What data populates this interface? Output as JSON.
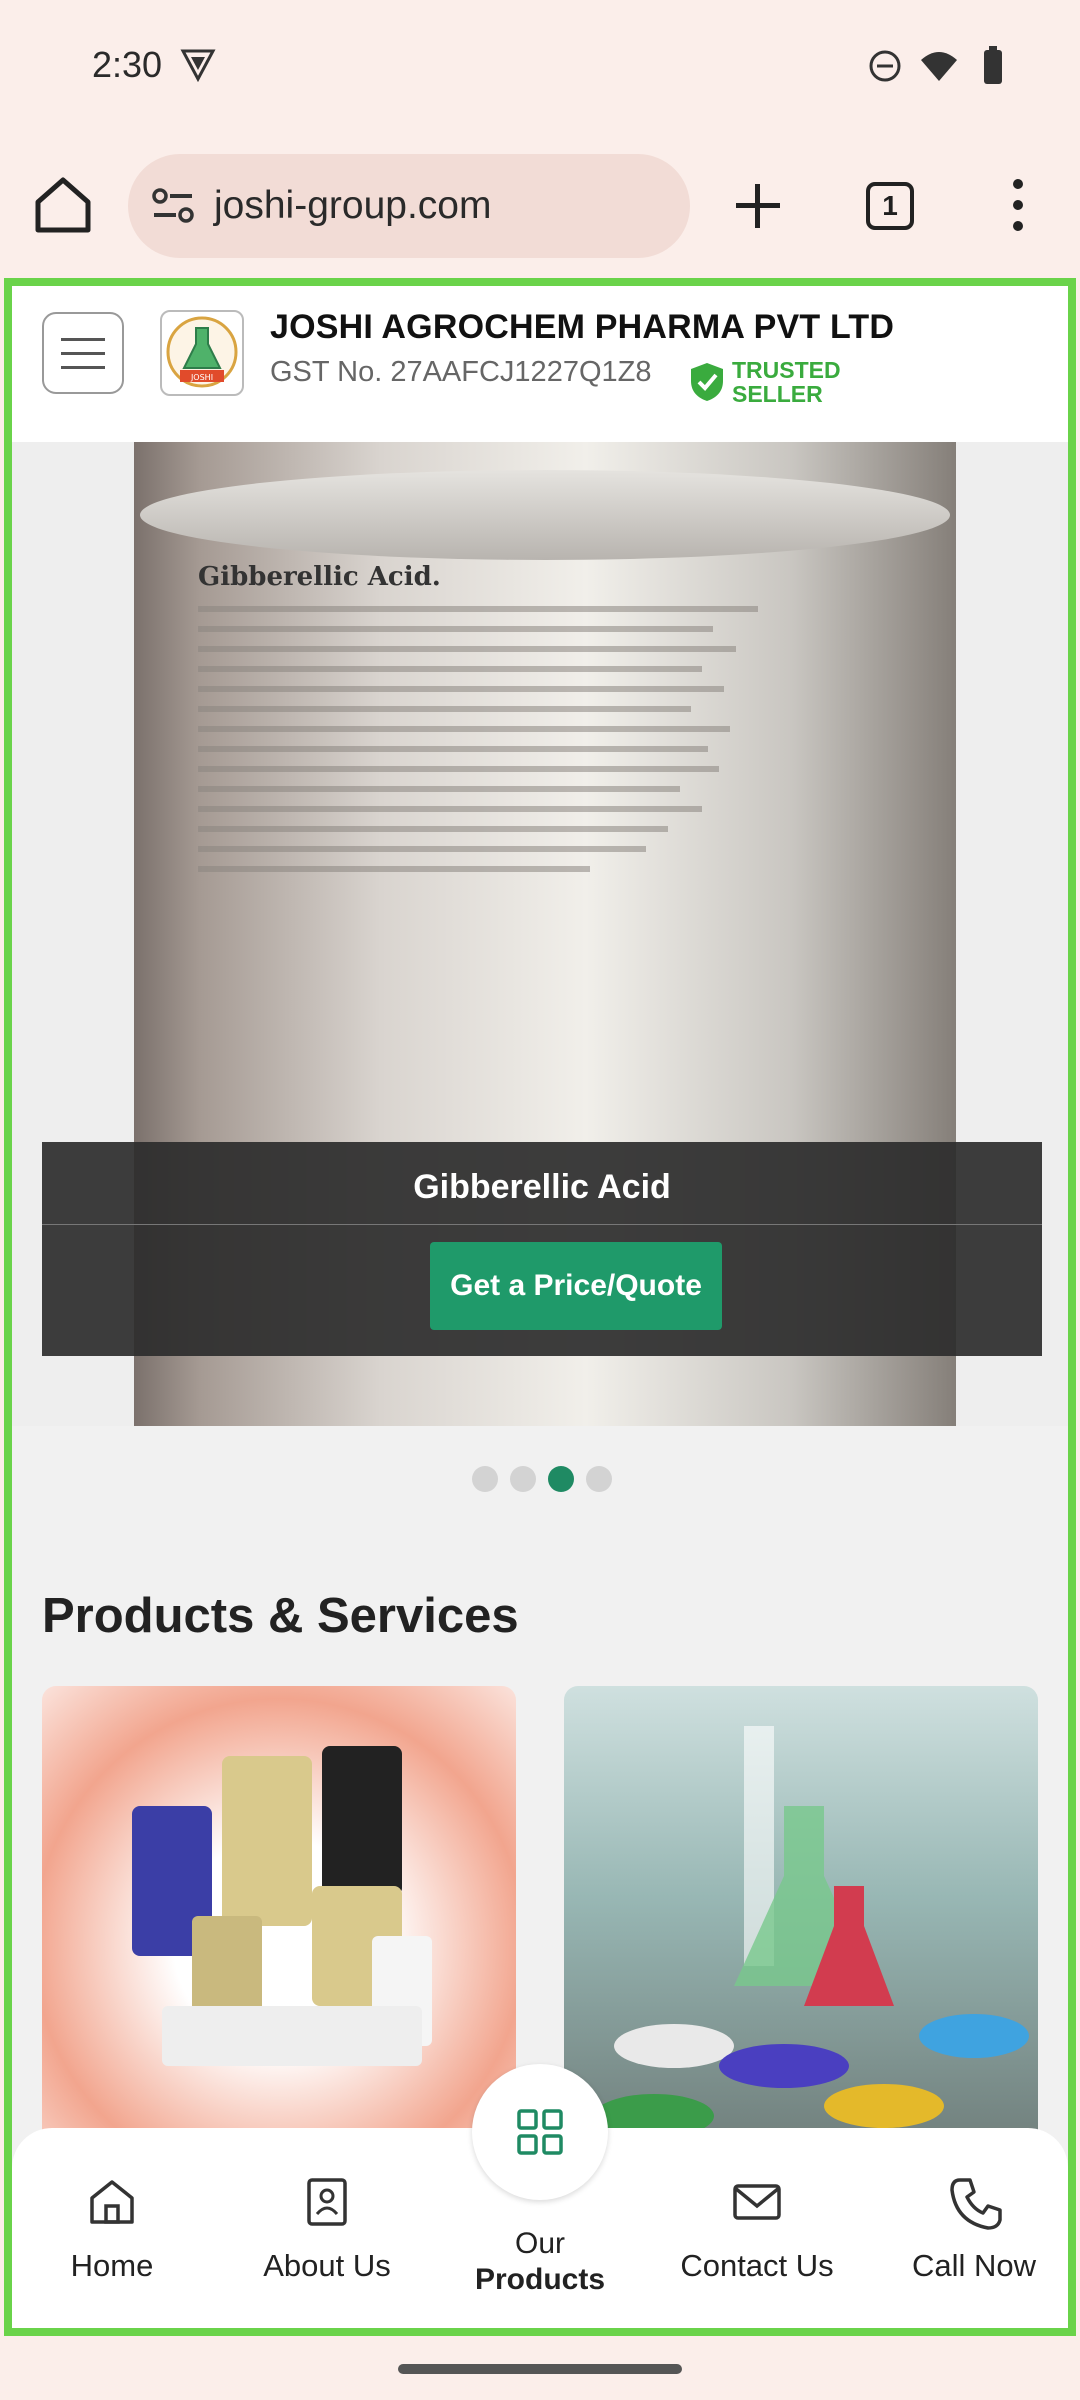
{
  "status_bar": {
    "time": "2:30"
  },
  "browser": {
    "url": "joshi-group.com",
    "tab_count": "1"
  },
  "header": {
    "company": "JOSHI AGROCHEM PHARMA PVT LTD",
    "gst": "GST No. 27AAFCJ1227Q1Z8",
    "badge_line1": "TRUSTED",
    "badge_line2": "SELLER",
    "logo_text": "JOSHI"
  },
  "banner": {
    "product_title": "Gibberellic Acid",
    "cta": "Get a Price/Quote",
    "label_heading": "Gibberellic Acid.",
    "slides_total": 4,
    "active_slide": 3
  },
  "section": {
    "title": "Products & Services"
  },
  "bottom_nav": {
    "home": "Home",
    "about": "About Us",
    "products_line1": "Our",
    "products_line2": "Products",
    "contact": "Contact Us",
    "call": "Call Now"
  },
  "colors": {
    "accent": "#1f9a6a",
    "frame": "#6ad34a",
    "trusted": "#3aab3e"
  }
}
